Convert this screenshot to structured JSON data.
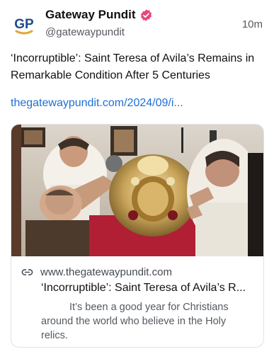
{
  "post": {
    "author_name": "Gateway Pundit",
    "handle": "@gatewaypundit",
    "time": "10m",
    "text": "‘Incorruptible’: Saint Teresa of Avila’s Remains in Remarkable Condition After 5 Centuries",
    "link_text": "thegatewaypundit.com/2024/09/i...",
    "avatar_letters": "GP"
  },
  "card": {
    "domain": "www.thegatewaypundit.com",
    "title": "‘Incorruptible’: Saint Teresa of Avila’s R...",
    "description": "It’s been a good year for Christians around the world who believe in the Holy relics."
  },
  "colors": {
    "verified_badge": "#e8457a",
    "link": "#1d6fd6",
    "logo_blue": "#1f4b8e",
    "logo_gold": "#e0a93a"
  },
  "icons": {
    "verified": "verified-badge-icon",
    "link": "link-icon"
  }
}
